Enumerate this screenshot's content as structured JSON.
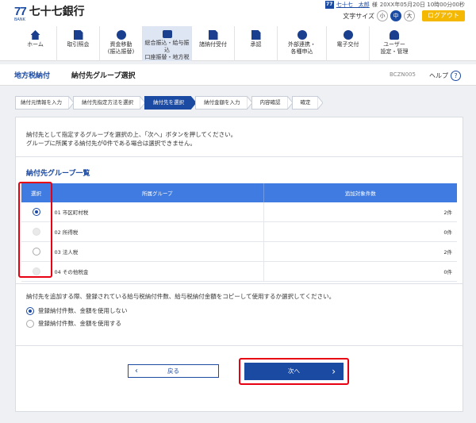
{
  "header": {
    "logo_mark": "77",
    "logo_sub": "BANK",
    "bank_name": "七十七銀行",
    "user_badge": "77",
    "user_name": "七十七　太郎",
    "user_suffix": "様",
    "datetime": "20XX年05月20日 10時00分00秒",
    "text_size_label": "文字サイズ",
    "size_small": "小",
    "size_medium": "中",
    "size_large": "大",
    "logout_label": "ログアウト",
    "brand_color": "#1b4aa3",
    "logout_color": "#f5b800"
  },
  "nav": [
    {
      "label": "ホーム",
      "icon": "home-icon"
    },
    {
      "label": "取引照会",
      "icon": "document-icon"
    },
    {
      "label": "資金移動\n(振込振替)",
      "icon": "money-transfer-icon"
    },
    {
      "label": "総合振込・給与振込\n口座振替・地方税",
      "icon": "bulk-transfer-icon"
    },
    {
      "label": "諸納付受付",
      "icon": "payment-icon"
    },
    {
      "label": "承認",
      "icon": "approval-icon"
    },
    {
      "label": "外部連携・\n各種申込",
      "icon": "link-icon"
    },
    {
      "label": "電子交付",
      "icon": "e-delivery-icon"
    },
    {
      "label": "ユーザー\n設定・管理",
      "icon": "user-settings-icon"
    }
  ],
  "title_bar": {
    "category": "地方税納付",
    "title": "納付先グループ選択",
    "screen_code": "BCZN005",
    "help_label": "ヘルプ",
    "help_icon": "?"
  },
  "steps": [
    {
      "label": "納付元情報を入力",
      "active": false
    },
    {
      "label": "納付先指定方法を選択",
      "active": false
    },
    {
      "label": "納付先を選択",
      "active": true
    },
    {
      "label": "納付金額を入力",
      "active": false
    },
    {
      "label": "内容確認",
      "active": false
    },
    {
      "label": "確定",
      "active": false
    }
  ],
  "intro": {
    "line1": "納付先として指定するグループを選択の上、「次へ」ボタンを押してください。",
    "line2": "グループに所属する納付先が0件である場合は選択できません。"
  },
  "group_section": {
    "title": "納付先グループ一覧",
    "col_select": "選択",
    "col_group": "所属グループ",
    "col_count": "追加対象件数",
    "rows": [
      {
        "group": "01 市区町村税",
        "count": "2件",
        "state": "selected"
      },
      {
        "group": "02 所得税",
        "count": "0件",
        "state": "disabled"
      },
      {
        "group": "03 法人税",
        "count": "2件",
        "state": "unselected"
      },
      {
        "group": "04 その他税金",
        "count": "0件",
        "state": "disabled"
      }
    ]
  },
  "copy_section": {
    "note": "納付先を追加する際、登録されている給与税納付件数、給与税納付金額をコピーして使用するか選択してください。",
    "option1": "登録納付件数、金額を使用しない",
    "option1_selected": true,
    "option2": "登録納付件数、金額を使用する",
    "option2_selected": false
  },
  "buttons": {
    "back_label": "戻る",
    "back_icon": "‹",
    "next_label": "次へ",
    "next_icon": "›"
  },
  "highlight_color": "#e60012"
}
